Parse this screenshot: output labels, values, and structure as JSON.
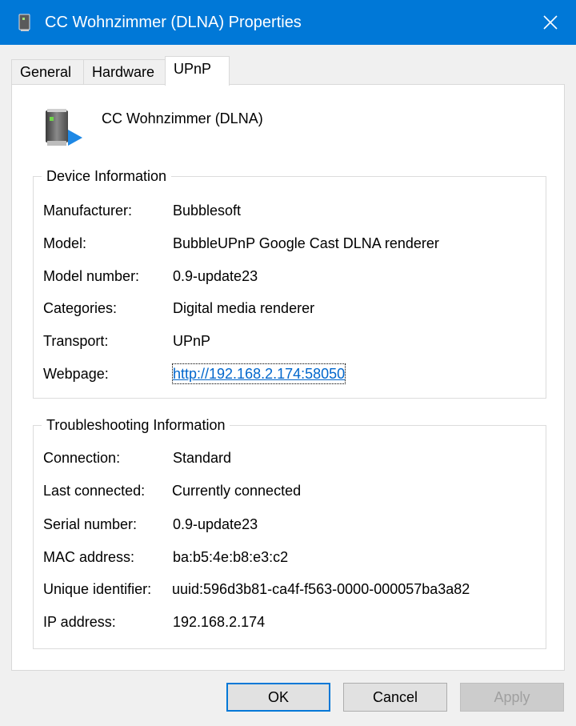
{
  "window": {
    "title": "CC Wohnzimmer (DLNA) Properties",
    "icon": "media-device-icon",
    "accent_color": "#0078d7"
  },
  "tabs": [
    {
      "label": "General",
      "active": false
    },
    {
      "label": "Hardware",
      "active": false
    },
    {
      "label": "UPnP",
      "active": true
    }
  ],
  "device": {
    "name": "CC Wohnzimmer (DLNA)",
    "icon": "media-device-icon"
  },
  "device_info": {
    "title": "Device Information",
    "rows": [
      {
        "label": "Manufacturer:",
        "value": "Bubblesoft"
      },
      {
        "label": "Model:",
        "value": "BubbleUPnP Google Cast DLNA renderer"
      },
      {
        "label": "Model number:",
        "value": "0.9-update23"
      },
      {
        "label": "Categories:",
        "value": "Digital media renderer"
      },
      {
        "label": "Transport:",
        "value": "UPnP"
      },
      {
        "label": "Webpage:",
        "value": "http://192.168.2.174:58050"
      }
    ]
  },
  "troubleshooting": {
    "title": "Troubleshooting Information",
    "rows": [
      {
        "label": "Connection:",
        "value": "Standard"
      },
      {
        "label": "Last connected:",
        "value": "Currently connected"
      },
      {
        "label": "Serial number:",
        "value": "0.9-update23"
      },
      {
        "label": "MAC address:",
        "value": "ba:b5:4e:b8:e3:c2"
      },
      {
        "label": "Unique identifier:",
        "value": "uuid:596d3b81-ca4f-f563-0000-000057ba3a82"
      },
      {
        "label": "IP address:",
        "value": "192.168.2.174"
      }
    ]
  },
  "buttons": {
    "ok": "OK",
    "cancel": "Cancel",
    "apply": "Apply"
  }
}
